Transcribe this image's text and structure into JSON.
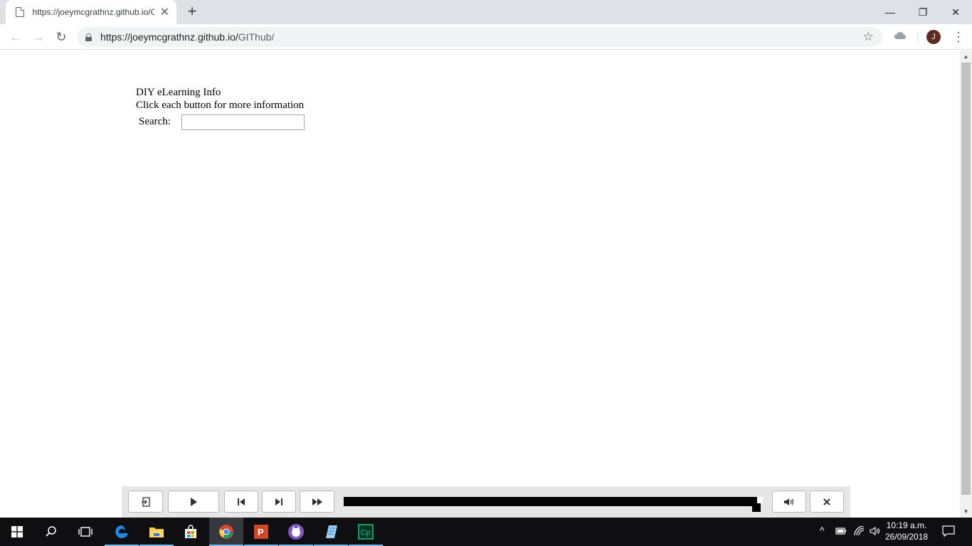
{
  "browser": {
    "tab_title": "https://joeymcgrathnz.github.io/GIThub/",
    "tab_close": "✕",
    "new_tab": "+",
    "window_controls": {
      "minimize": "—",
      "restore": "❐",
      "close": "✕"
    },
    "nav": {
      "back": "←",
      "forward": "→",
      "reload": "↻"
    },
    "url_host": "https://joeymcgrathnz.github.io/",
    "url_path": "GIThub/",
    "bookmark_icon": "☆",
    "avatar_initial": "J",
    "menu_icon": "⋮"
  },
  "page": {
    "heading": "DIY eLearning Info",
    "subheading": "Click each button for more information",
    "search": {
      "label": "Search:",
      "value": "",
      "placeholder": ""
    }
  },
  "player": {
    "exit_icon": "⎗",
    "play_icon": "▶",
    "prev_icon": "⏮",
    "next_icon": "⏭",
    "fast_forward_icon": "⏩",
    "volume_icon": "🔊",
    "close_icon": "✕",
    "progress_fraction": 0.99
  },
  "taskbar": {
    "apps": [
      "start",
      "search",
      "task-view",
      "edge",
      "file-explorer",
      "store",
      "chrome",
      "powerpoint",
      "app-cat",
      "notes",
      "captivate"
    ],
    "captivate_label": "Cp",
    "powerpoint_label": "P",
    "time": "10:19 a.m.",
    "date": "26/09/2018",
    "tray": {
      "chevron": "^",
      "battery": "▭",
      "wifi": "◜",
      "volume": "🔈",
      "notifications": "▢"
    }
  }
}
